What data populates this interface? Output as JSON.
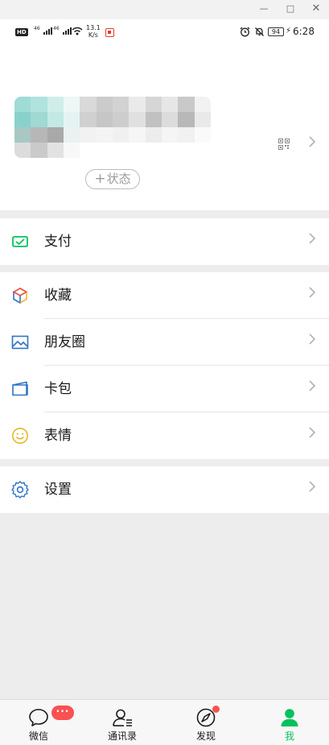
{
  "window": {
    "min": "—",
    "max": "□",
    "close": "✕"
  },
  "status_bar": {
    "hd": "HD",
    "sig1": "46",
    "sig2": "46",
    "speed_value": "13.1",
    "speed_unit": "K/s",
    "battery": "94",
    "time": "6:28"
  },
  "profile": {
    "avatar_name": "blurred-profile",
    "status_plus": "+",
    "status_label": "状态"
  },
  "menu": {
    "pay": {
      "label": "支付",
      "icon": "pay-icon",
      "color": "#07c160"
    },
    "favorites": {
      "label": "收藏",
      "icon": "cube-icon"
    },
    "moments": {
      "label": "朋友圈",
      "icon": "image-icon",
      "color": "#2f73c5"
    },
    "cards": {
      "label": "卡包",
      "icon": "wallet-icon",
      "color": "#2f73c5"
    },
    "stickers": {
      "label": "表情",
      "icon": "smile-icon",
      "color": "#e7b82a"
    },
    "settings": {
      "label": "设置",
      "icon": "gear-icon",
      "color": "#2f73c5"
    }
  },
  "tabs": [
    {
      "label": "微信",
      "icon": "chat-icon",
      "badge": "···"
    },
    {
      "label": "通讯录",
      "icon": "contacts-icon"
    },
    {
      "label": "发现",
      "icon": "compass-icon"
    },
    {
      "label": "我",
      "icon": "person-icon",
      "active": true
    }
  ],
  "colors": {
    "accent": "#07c160",
    "badge": "#fa5151",
    "chevron": "#b2b2b2",
    "background": "#ededed"
  }
}
